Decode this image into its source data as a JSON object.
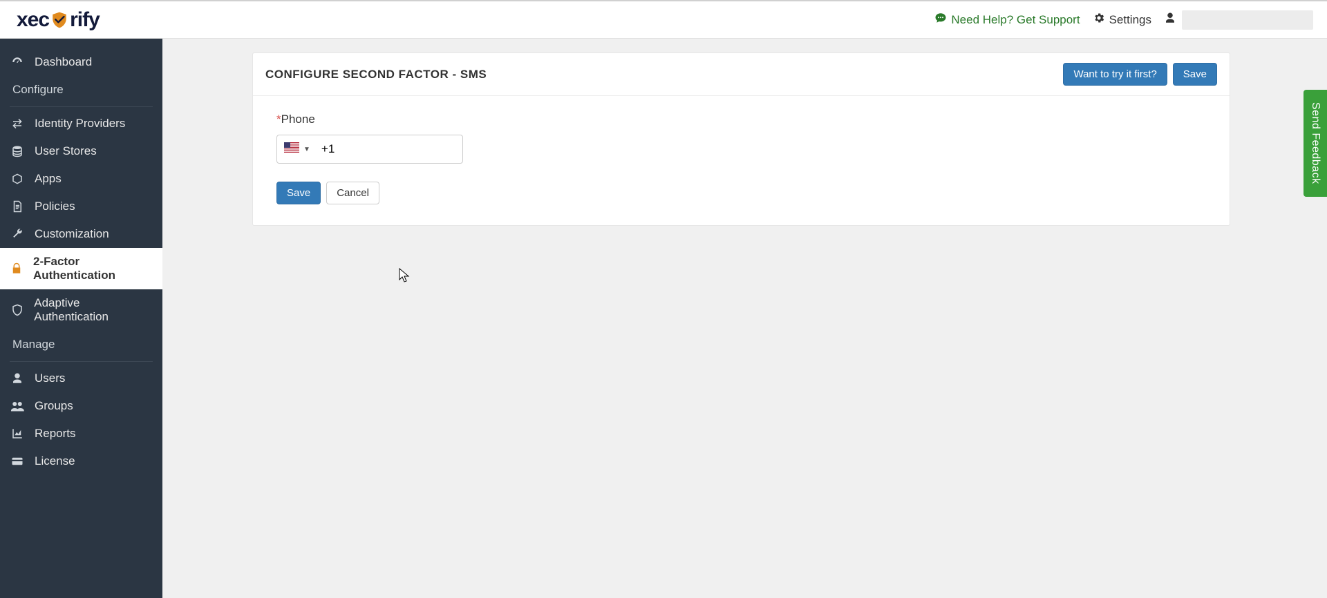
{
  "brand": {
    "part1": "xec",
    "part2": "rify"
  },
  "topbar": {
    "support": "Need Help? Get Support",
    "settings": "Settings"
  },
  "sidebar": {
    "items": [
      {
        "label": "Dashboard"
      }
    ],
    "configure_label": "Configure",
    "configure_items": [
      {
        "label": "Identity Providers"
      },
      {
        "label": "User Stores"
      },
      {
        "label": "Apps"
      },
      {
        "label": "Policies"
      },
      {
        "label": "Customization"
      },
      {
        "label": "2-Factor Authentication"
      },
      {
        "label": "Adaptive Authentication"
      }
    ],
    "manage_label": "Manage",
    "manage_items": [
      {
        "label": "Users"
      },
      {
        "label": "Groups"
      },
      {
        "label": "Reports"
      },
      {
        "label": "License"
      }
    ]
  },
  "panel": {
    "title": "CONFIGURE SECOND FACTOR - SMS",
    "try_first": "Want to try it first?",
    "save_top": "Save",
    "phone_label": "Phone",
    "phone_value": "+1",
    "save": "Save",
    "cancel": "Cancel"
  },
  "feedback": "Send Feedback"
}
